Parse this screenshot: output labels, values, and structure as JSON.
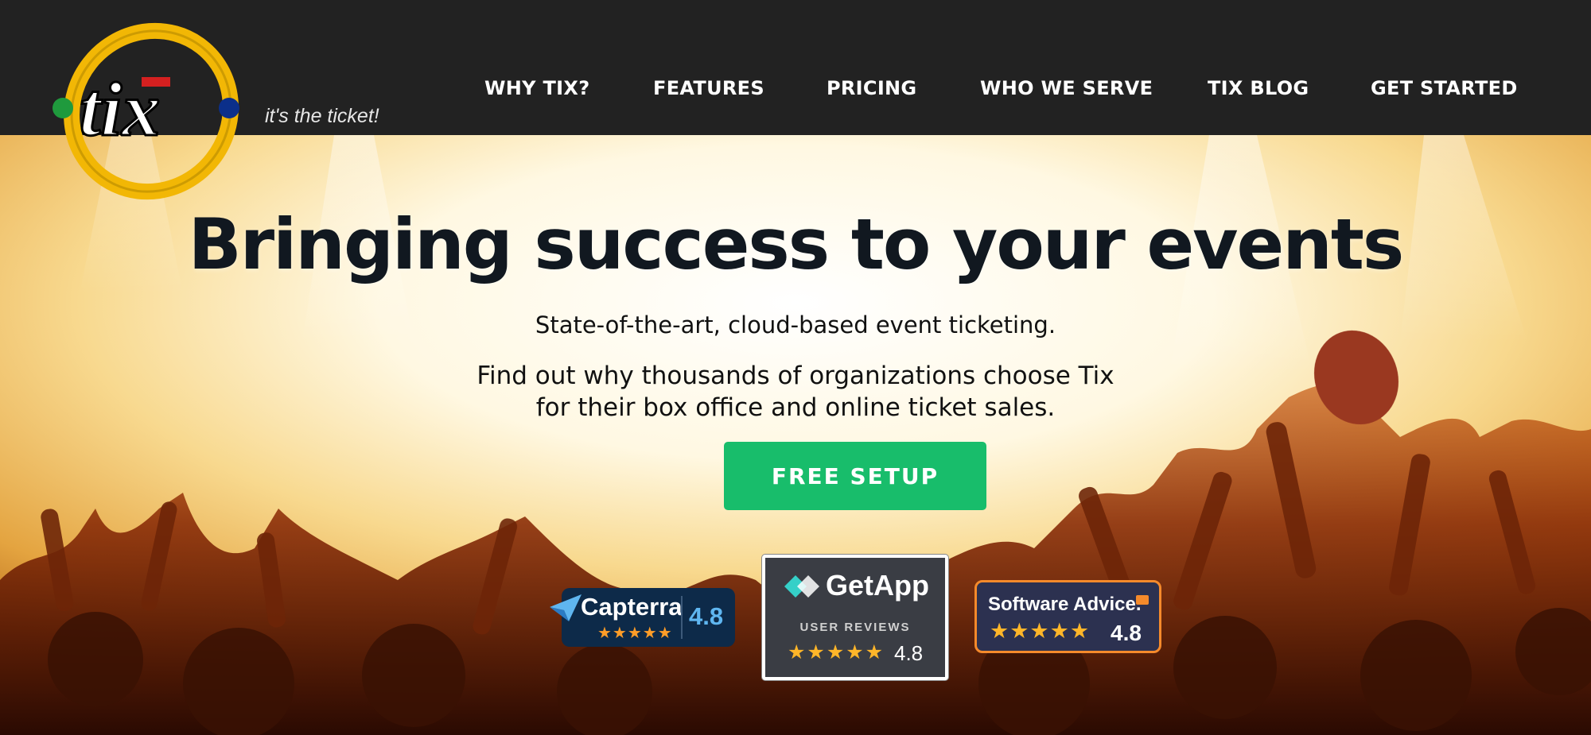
{
  "brand": {
    "logo_text": "tix",
    "tagline": "it's the ticket!"
  },
  "nav": {
    "items": [
      {
        "label": "WHY TIX?"
      },
      {
        "label": "FEATURES"
      },
      {
        "label": "PRICING"
      },
      {
        "label": "WHO WE SERVE"
      },
      {
        "label": "TIX BLOG"
      },
      {
        "label": "GET STARTED"
      }
    ]
  },
  "hero": {
    "headline": "Bringing success to your events",
    "subheadline": "State-of-the-art, cloud-based event ticketing.",
    "description_line1": "Find out why thousands of organizations choose Tix",
    "description_line2": "for their box office and online ticket sales.",
    "cta_label": "FREE SETUP"
  },
  "badges": {
    "capterra": {
      "name": "Capterra",
      "score": "4.8",
      "stars": "★★★★★"
    },
    "getapp": {
      "name": "GetApp",
      "subtitle": "USER REVIEWS",
      "score": "4.8",
      "stars": "★★★★★"
    },
    "software_advice": {
      "name": "Software Advice.",
      "score": "4.8",
      "stars": "★★★★★"
    }
  },
  "colors": {
    "header_bg": "#222222",
    "cta_green": "#18bd6b",
    "logo_yellow": "#f2b705",
    "logo_red": "#d42020",
    "logo_green": "#1f9a3d",
    "logo_blue": "#0b2f8a"
  }
}
